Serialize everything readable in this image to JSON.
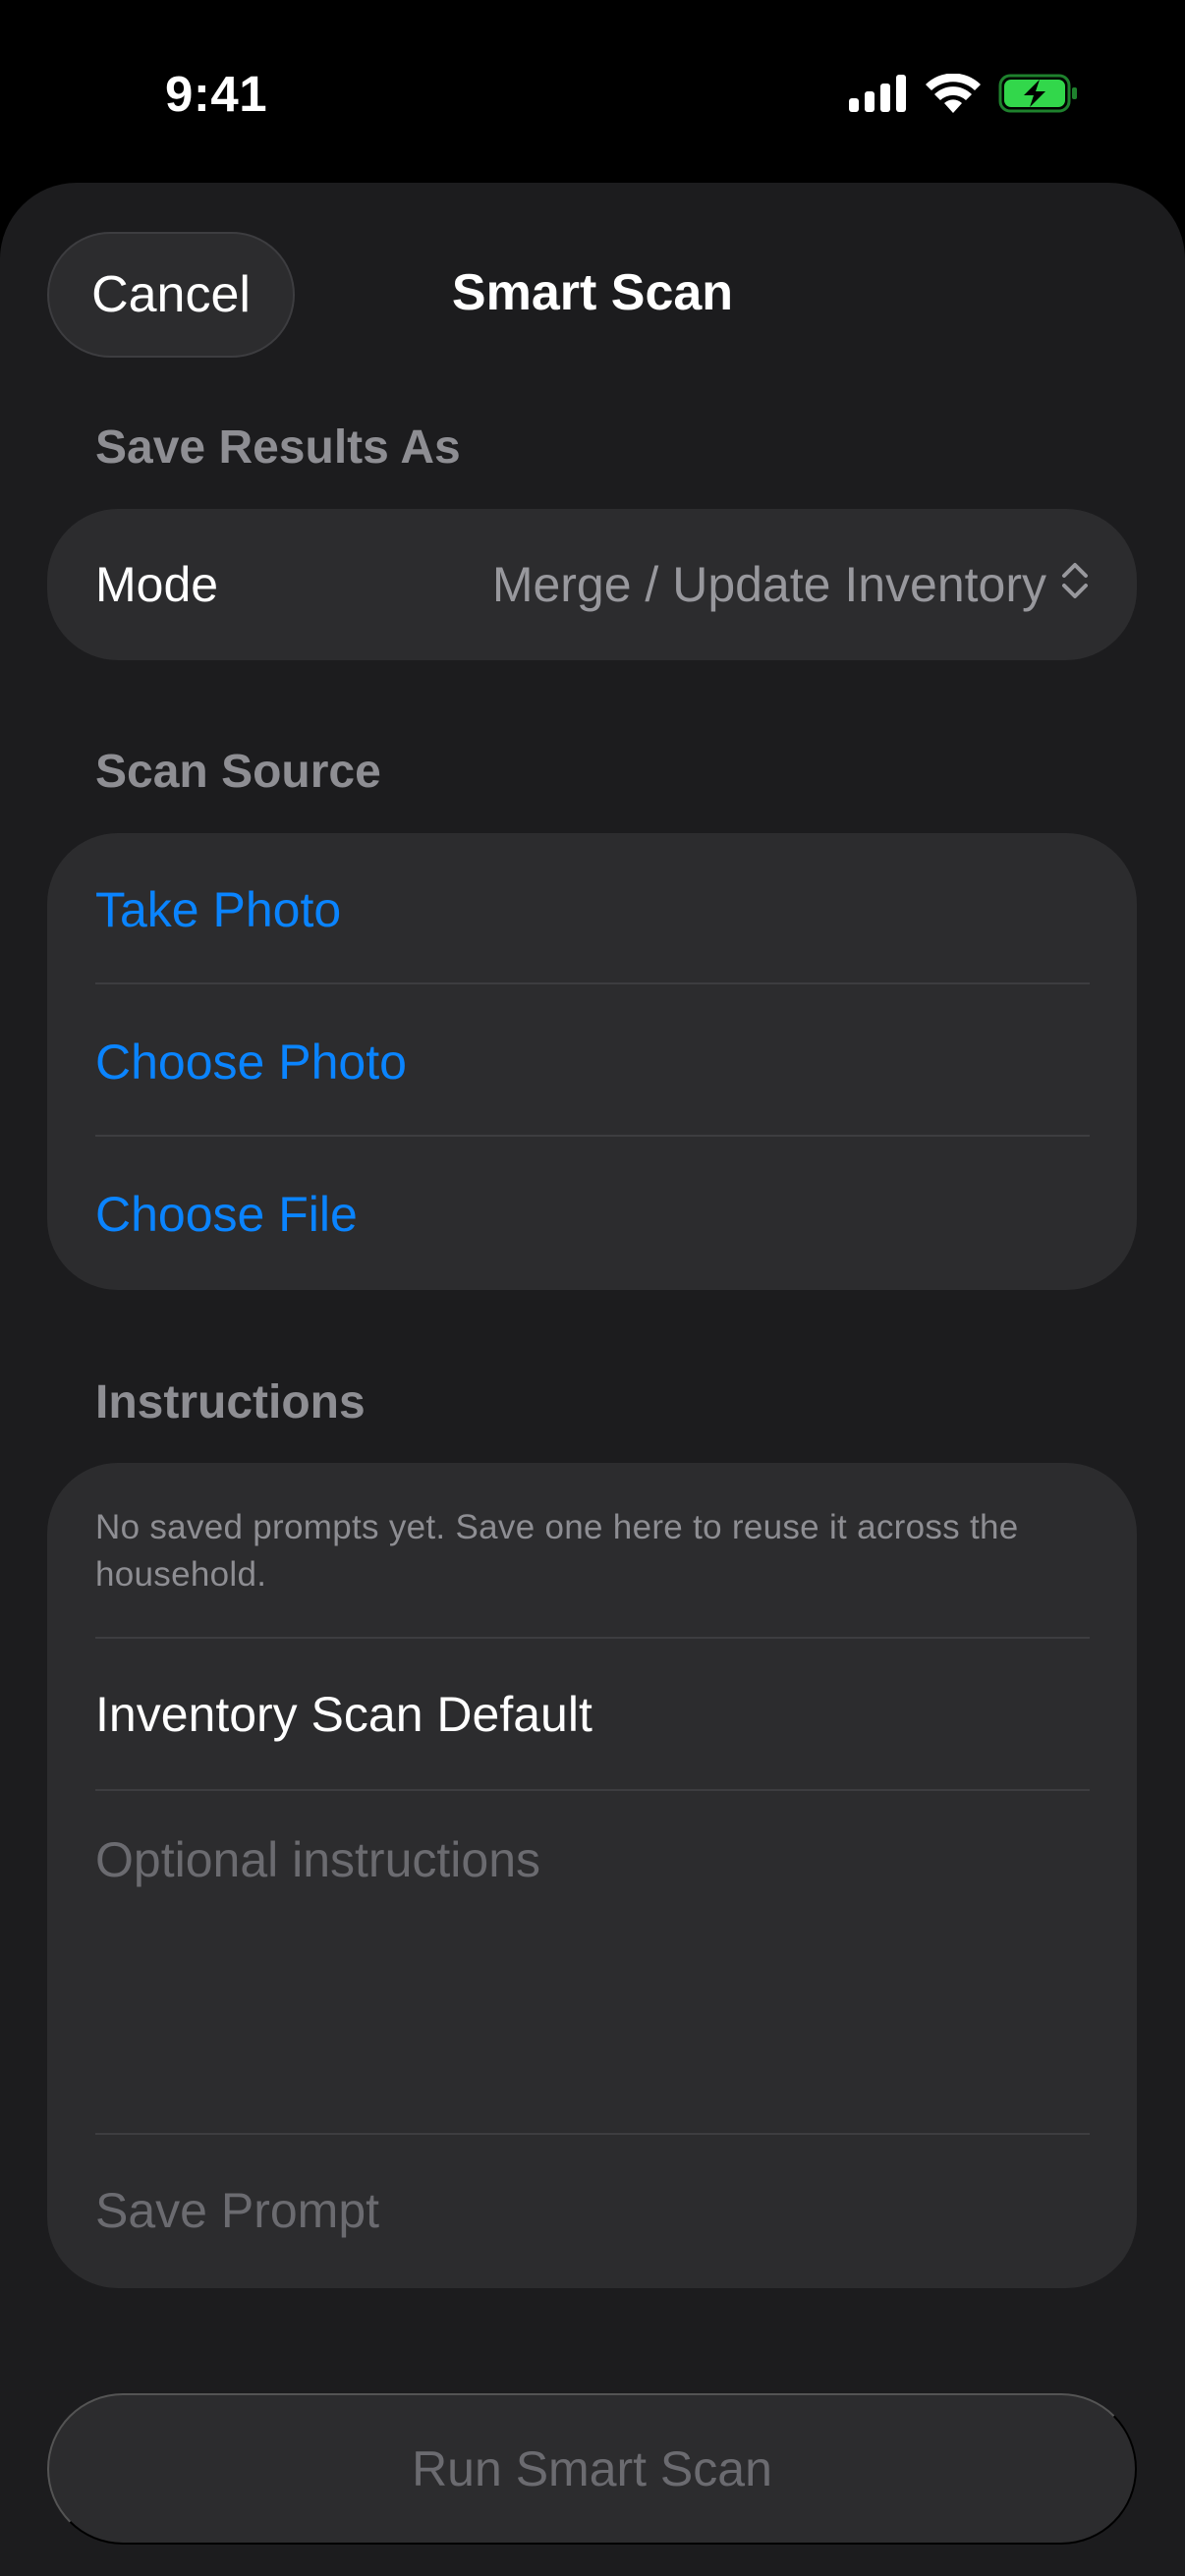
{
  "status_bar": {
    "time": "9:41",
    "icons": [
      "cellular-signal-icon",
      "wifi-icon",
      "battery-charging-icon"
    ],
    "battery_color": "#32d74b"
  },
  "nav": {
    "cancel_label": "Cancel",
    "title": "Smart Scan"
  },
  "save_results": {
    "header": "Save Results As",
    "mode_label": "Mode",
    "mode_value": "Merge / Update Inventory"
  },
  "scan_source": {
    "header": "Scan Source",
    "items": [
      {
        "label": "Take Photo"
      },
      {
        "label": "Choose Photo"
      },
      {
        "label": "Choose File"
      }
    ]
  },
  "instructions": {
    "header": "Instructions",
    "hint": "No saved prompts yet. Save one here to reuse it across the household.",
    "prompt_name": "Inventory Scan Default",
    "placeholder": "Optional instructions",
    "save_label": "Save Prompt"
  },
  "run_button": {
    "label": "Run Smart Scan"
  },
  "colors": {
    "accent": "#0a84ff",
    "background": "#1c1c1e",
    "card": "#2c2c2e"
  }
}
